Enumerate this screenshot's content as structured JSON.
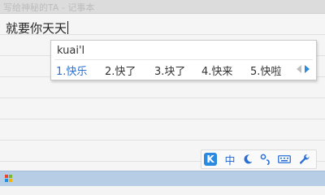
{
  "window": {
    "title": "写给神秘的TA - 记事本"
  },
  "editor": {
    "text": "就要你天天"
  },
  "ime": {
    "composition": "kuai'l",
    "candidates": [
      {
        "index": "1.",
        "word": "快乐",
        "selected": true
      },
      {
        "index": "2.",
        "word": "快了",
        "selected": false
      },
      {
        "index": "3.",
        "word": "块了",
        "selected": false
      },
      {
        "index": "4.",
        "word": "快来",
        "selected": false
      },
      {
        "index": "5.",
        "word": "快啦",
        "selected": false
      }
    ],
    "prev_icon": "page-prev-icon",
    "next_icon": "page-next-icon"
  },
  "ime_toolbar": {
    "logo_letter": "K",
    "mode_label": "中",
    "icons": [
      "ime-logo-icon",
      "chinese-mode-icon",
      "moon-icon",
      "punctuation-icon",
      "keyboard-icon",
      "wrench-icon"
    ]
  },
  "colors": {
    "accent": "#2a8ae0",
    "selected_candidate": "#2a6fd6",
    "taskbar": "#b7cde6"
  }
}
